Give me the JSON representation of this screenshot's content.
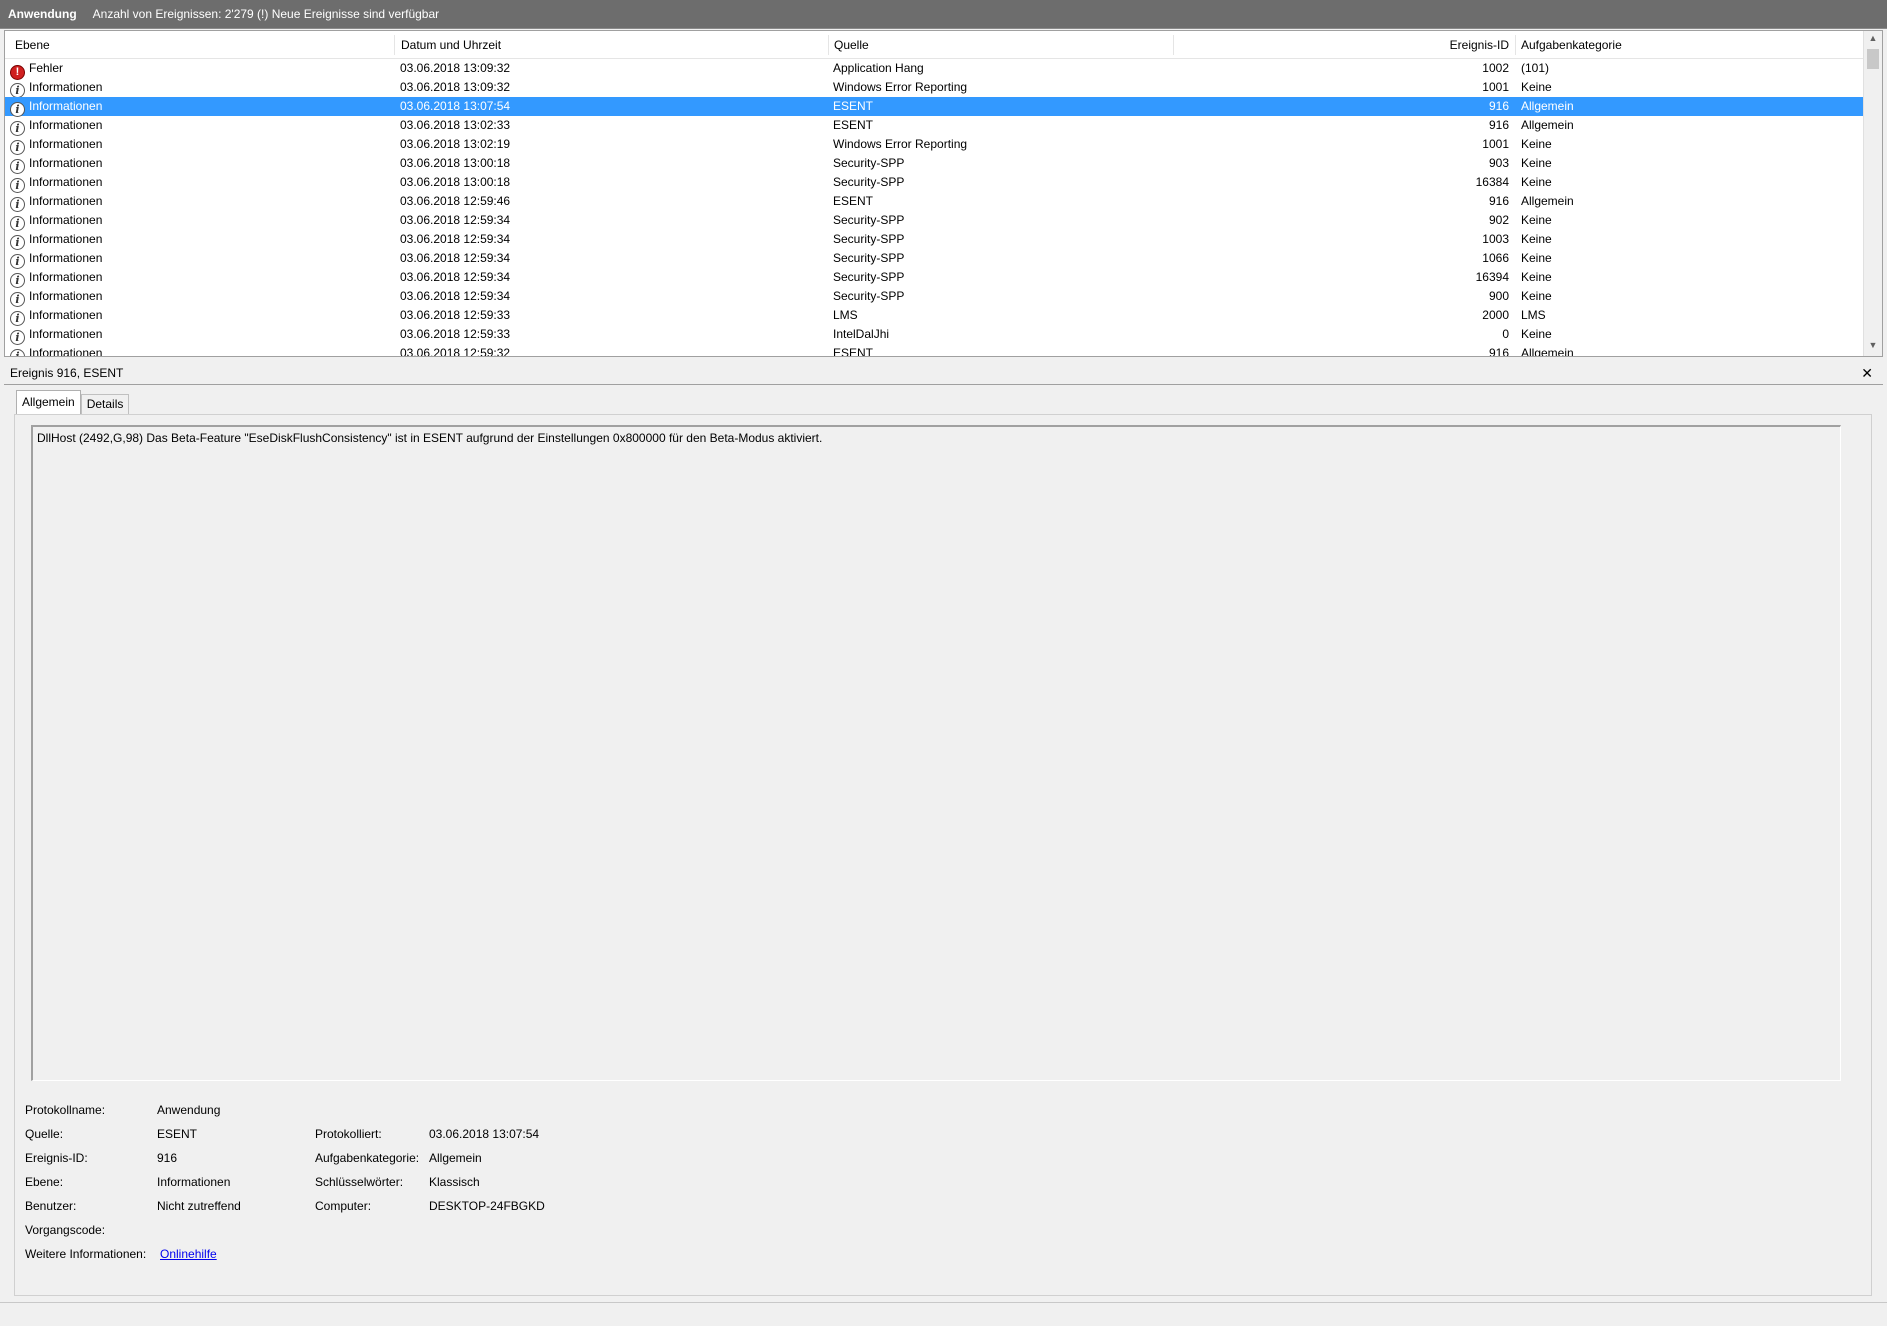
{
  "titlebar": {
    "title": "Anwendung",
    "status": "Anzahl von Ereignissen: 2'279 (!) Neue Ereignisse sind verfügbar"
  },
  "list": {
    "columns": {
      "level": "Ebene",
      "date": "Datum und Uhrzeit",
      "source": "Quelle",
      "id": "Ereignis-ID",
      "category": "Aufgabenkategorie"
    },
    "rows": [
      {
        "icon": "error-icon",
        "level": "Fehler",
        "date": "03.06.2018 13:09:32",
        "source": "Application Hang",
        "id": "1002",
        "category": "(101)",
        "selected": false
      },
      {
        "icon": "info-icon",
        "level": "Informationen",
        "date": "03.06.2018 13:09:32",
        "source": "Windows Error Reporting",
        "id": "1001",
        "category": "Keine",
        "selected": false
      },
      {
        "icon": "info-icon",
        "level": "Informationen",
        "date": "03.06.2018 13:07:54",
        "source": "ESENT",
        "id": "916",
        "category": "Allgemein",
        "selected": true
      },
      {
        "icon": "info-icon",
        "level": "Informationen",
        "date": "03.06.2018 13:02:33",
        "source": "ESENT",
        "id": "916",
        "category": "Allgemein",
        "selected": false
      },
      {
        "icon": "info-icon",
        "level": "Informationen",
        "date": "03.06.2018 13:02:19",
        "source": "Windows Error Reporting",
        "id": "1001",
        "category": "Keine",
        "selected": false
      },
      {
        "icon": "info-icon",
        "level": "Informationen",
        "date": "03.06.2018 13:00:18",
        "source": "Security-SPP",
        "id": "903",
        "category": "Keine",
        "selected": false
      },
      {
        "icon": "info-icon",
        "level": "Informationen",
        "date": "03.06.2018 13:00:18",
        "source": "Security-SPP",
        "id": "16384",
        "category": "Keine",
        "selected": false
      },
      {
        "icon": "info-icon",
        "level": "Informationen",
        "date": "03.06.2018 12:59:46",
        "source": "ESENT",
        "id": "916",
        "category": "Allgemein",
        "selected": false
      },
      {
        "icon": "info-icon",
        "level": "Informationen",
        "date": "03.06.2018 12:59:34",
        "source": "Security-SPP",
        "id": "902",
        "category": "Keine",
        "selected": false
      },
      {
        "icon": "info-icon",
        "level": "Informationen",
        "date": "03.06.2018 12:59:34",
        "source": "Security-SPP",
        "id": "1003",
        "category": "Keine",
        "selected": false
      },
      {
        "icon": "info-icon",
        "level": "Informationen",
        "date": "03.06.2018 12:59:34",
        "source": "Security-SPP",
        "id": "1066",
        "category": "Keine",
        "selected": false
      },
      {
        "icon": "info-icon",
        "level": "Informationen",
        "date": "03.06.2018 12:59:34",
        "source": "Security-SPP",
        "id": "16394",
        "category": "Keine",
        "selected": false
      },
      {
        "icon": "info-icon",
        "level": "Informationen",
        "date": "03.06.2018 12:59:34",
        "source": "Security-SPP",
        "id": "900",
        "category": "Keine",
        "selected": false
      },
      {
        "icon": "info-icon",
        "level": "Informationen",
        "date": "03.06.2018 12:59:33",
        "source": "LMS",
        "id": "2000",
        "category": "LMS",
        "selected": false
      },
      {
        "icon": "info-icon",
        "level": "Informationen",
        "date": "03.06.2018 12:59:33",
        "source": "IntelDalJhi",
        "id": "0",
        "category": "Keine",
        "selected": false
      },
      {
        "icon": "info-icon",
        "level": "Informationen",
        "date": "03.06.2018 12:59:32",
        "source": "ESENT",
        "id": "916",
        "category": "Allgemein",
        "selected": false
      }
    ]
  },
  "detail": {
    "header": "Ereignis 916, ESENT",
    "close_glyph": "✕",
    "tabs": [
      "Allgemein",
      "Details"
    ],
    "description": "DllHost (2492,G,98) Das Beta-Feature \"EseDiskFlushConsistency\" ist in ESENT aufgrund der Einstellungen 0x800000 für den Beta-Modus aktiviert.",
    "props": {
      "log_label": "Protokollname:",
      "log_value": "Anwendung",
      "source_label": "Quelle:",
      "source_value": "ESENT",
      "logged_label": "Protokolliert:",
      "logged_value": "03.06.2018 13:07:54",
      "id_label": "Ereignis-ID:",
      "id_value": "916",
      "category_label": "Aufgabenkategorie:",
      "category_value": "Allgemein",
      "level_label": "Ebene:",
      "level_value": "Informationen",
      "keywords_label": "Schlüsselwörter:",
      "keywords_value": "Klassisch",
      "user_label": "Benutzer:",
      "user_value": "Nicht zutreffend",
      "computer_label": "Computer:",
      "computer_value": "DESKTOP-24FBGKD",
      "opcode_label": "Vorgangscode:",
      "more_label": "Weitere Informationen:",
      "more_link": "Onlinehilfe"
    }
  }
}
